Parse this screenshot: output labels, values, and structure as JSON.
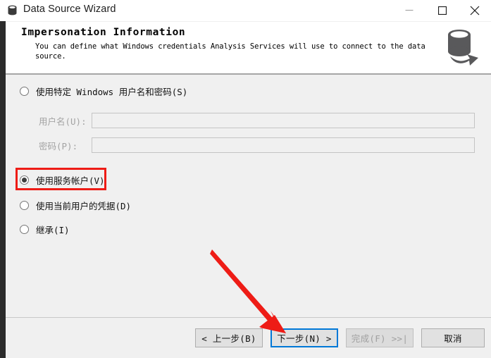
{
  "window": {
    "title": "Data Source Wizard",
    "title_icon": "database-icon",
    "controls": {
      "minimize": "minimize-icon",
      "maximize": "maximize-icon",
      "close": "close-icon"
    }
  },
  "header": {
    "title": "Impersonation Information",
    "description": "You can define what Windows credentials Analysis Services will use to connect to the data source.",
    "icon": "database-arrow-icon"
  },
  "form": {
    "options": [
      {
        "id": "specific-windows-credentials",
        "label": "使用特定 Windows 用户名和密码(S)",
        "checked": false
      },
      {
        "id": "service-account",
        "label": "使用服务帐户(V)",
        "checked": true
      },
      {
        "id": "current-user-credentials",
        "label": "使用当前用户的凭据(D)",
        "checked": false
      },
      {
        "id": "inherit",
        "label": "继承(I)",
        "checked": false
      }
    ],
    "fields": [
      {
        "id": "username",
        "label": "用户名(U):",
        "value": "",
        "placeholder": "",
        "disabled": true
      },
      {
        "id": "password",
        "label": "密码(P):",
        "value": "",
        "placeholder": "",
        "disabled": true
      }
    ]
  },
  "footer": {
    "buttons": [
      {
        "id": "back",
        "label": "< 上一步(B)",
        "state": "normal"
      },
      {
        "id": "next",
        "label": "下一步(N) >",
        "state": "default"
      },
      {
        "id": "finish",
        "label": "完成(F) >>|",
        "state": "disabled"
      },
      {
        "id": "cancel",
        "label": "取消",
        "state": "normal"
      }
    ]
  },
  "annotations": {
    "highlight_color": "#ee1c16",
    "arrow_color": "#ee1c16",
    "highlight_target": "使用服务帐户(V)",
    "arrow_target": "下一步(N) >"
  }
}
